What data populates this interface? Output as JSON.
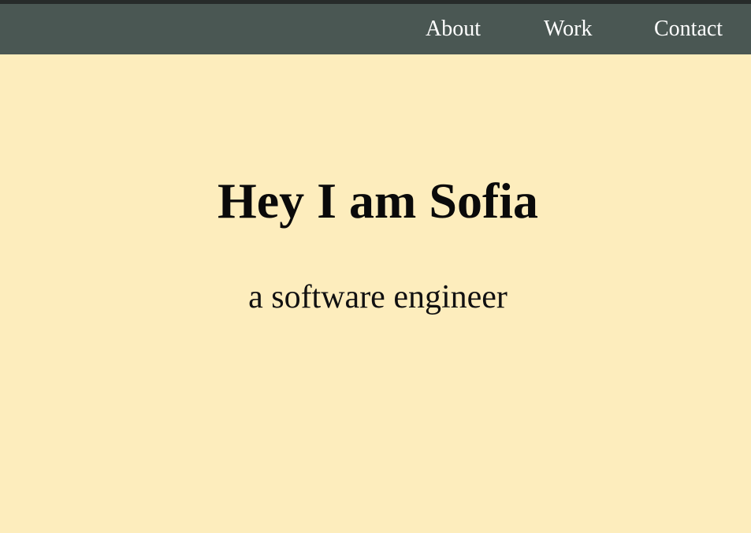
{
  "nav": {
    "items": [
      {
        "label": "About"
      },
      {
        "label": "Work"
      },
      {
        "label": "Contact"
      }
    ]
  },
  "hero": {
    "title": "Hey I am Sofia",
    "subtitle": "a software engineer"
  },
  "colors": {
    "background": "#fdedbd",
    "navbar": "#4a5753",
    "top_strip": "#272b2a",
    "nav_text": "#ffffff",
    "heading_text": "#0a0a0a"
  }
}
